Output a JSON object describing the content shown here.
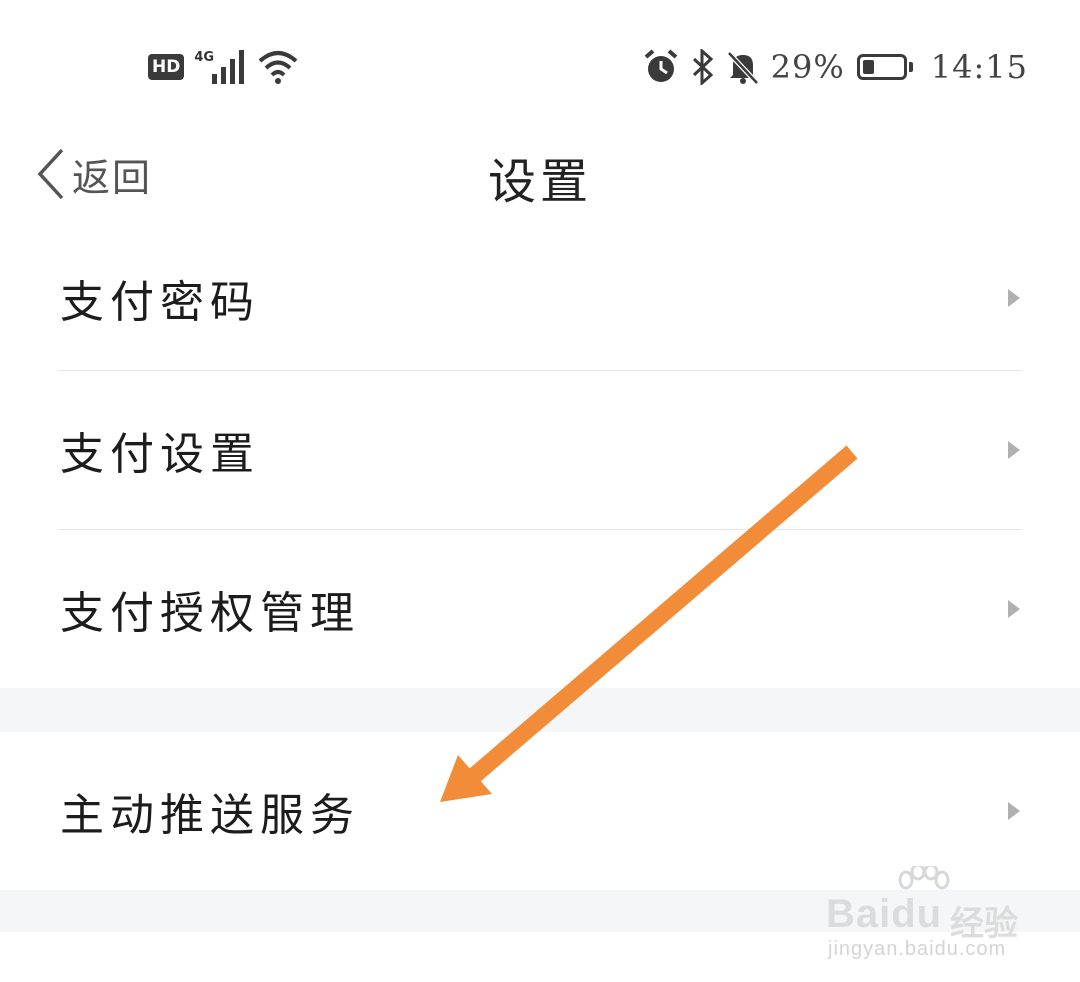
{
  "status_bar": {
    "hd_badge": "HD",
    "network": "4G",
    "battery_percent_text": "29%",
    "battery_level": 0.29,
    "time": "14:15",
    "icons": [
      "signal-icon",
      "wifi-icon",
      "alarm-icon",
      "bluetooth-icon",
      "mute-bell-icon",
      "battery-icon"
    ]
  },
  "nav": {
    "back_label": "返回",
    "title": "设置"
  },
  "settings": {
    "group1": [
      {
        "label": "支付密码"
      },
      {
        "label": "支付设置"
      },
      {
        "label": "支付授权管理"
      }
    ],
    "group2": [
      {
        "label": "主动推送服务"
      }
    ]
  },
  "annotation": {
    "arrow_color": "#f28c38",
    "points_to": "主动推送服务"
  },
  "watermark": {
    "brand": "Bai",
    "brand_suffix": "du",
    "sub": "经验",
    "url": "jingyan.baidu.com"
  },
  "colors": {
    "background": "#ffffff",
    "gap_band": "#f5f6f8",
    "divider": "#e6e6e6",
    "arrow": "#b0b0b0"
  }
}
